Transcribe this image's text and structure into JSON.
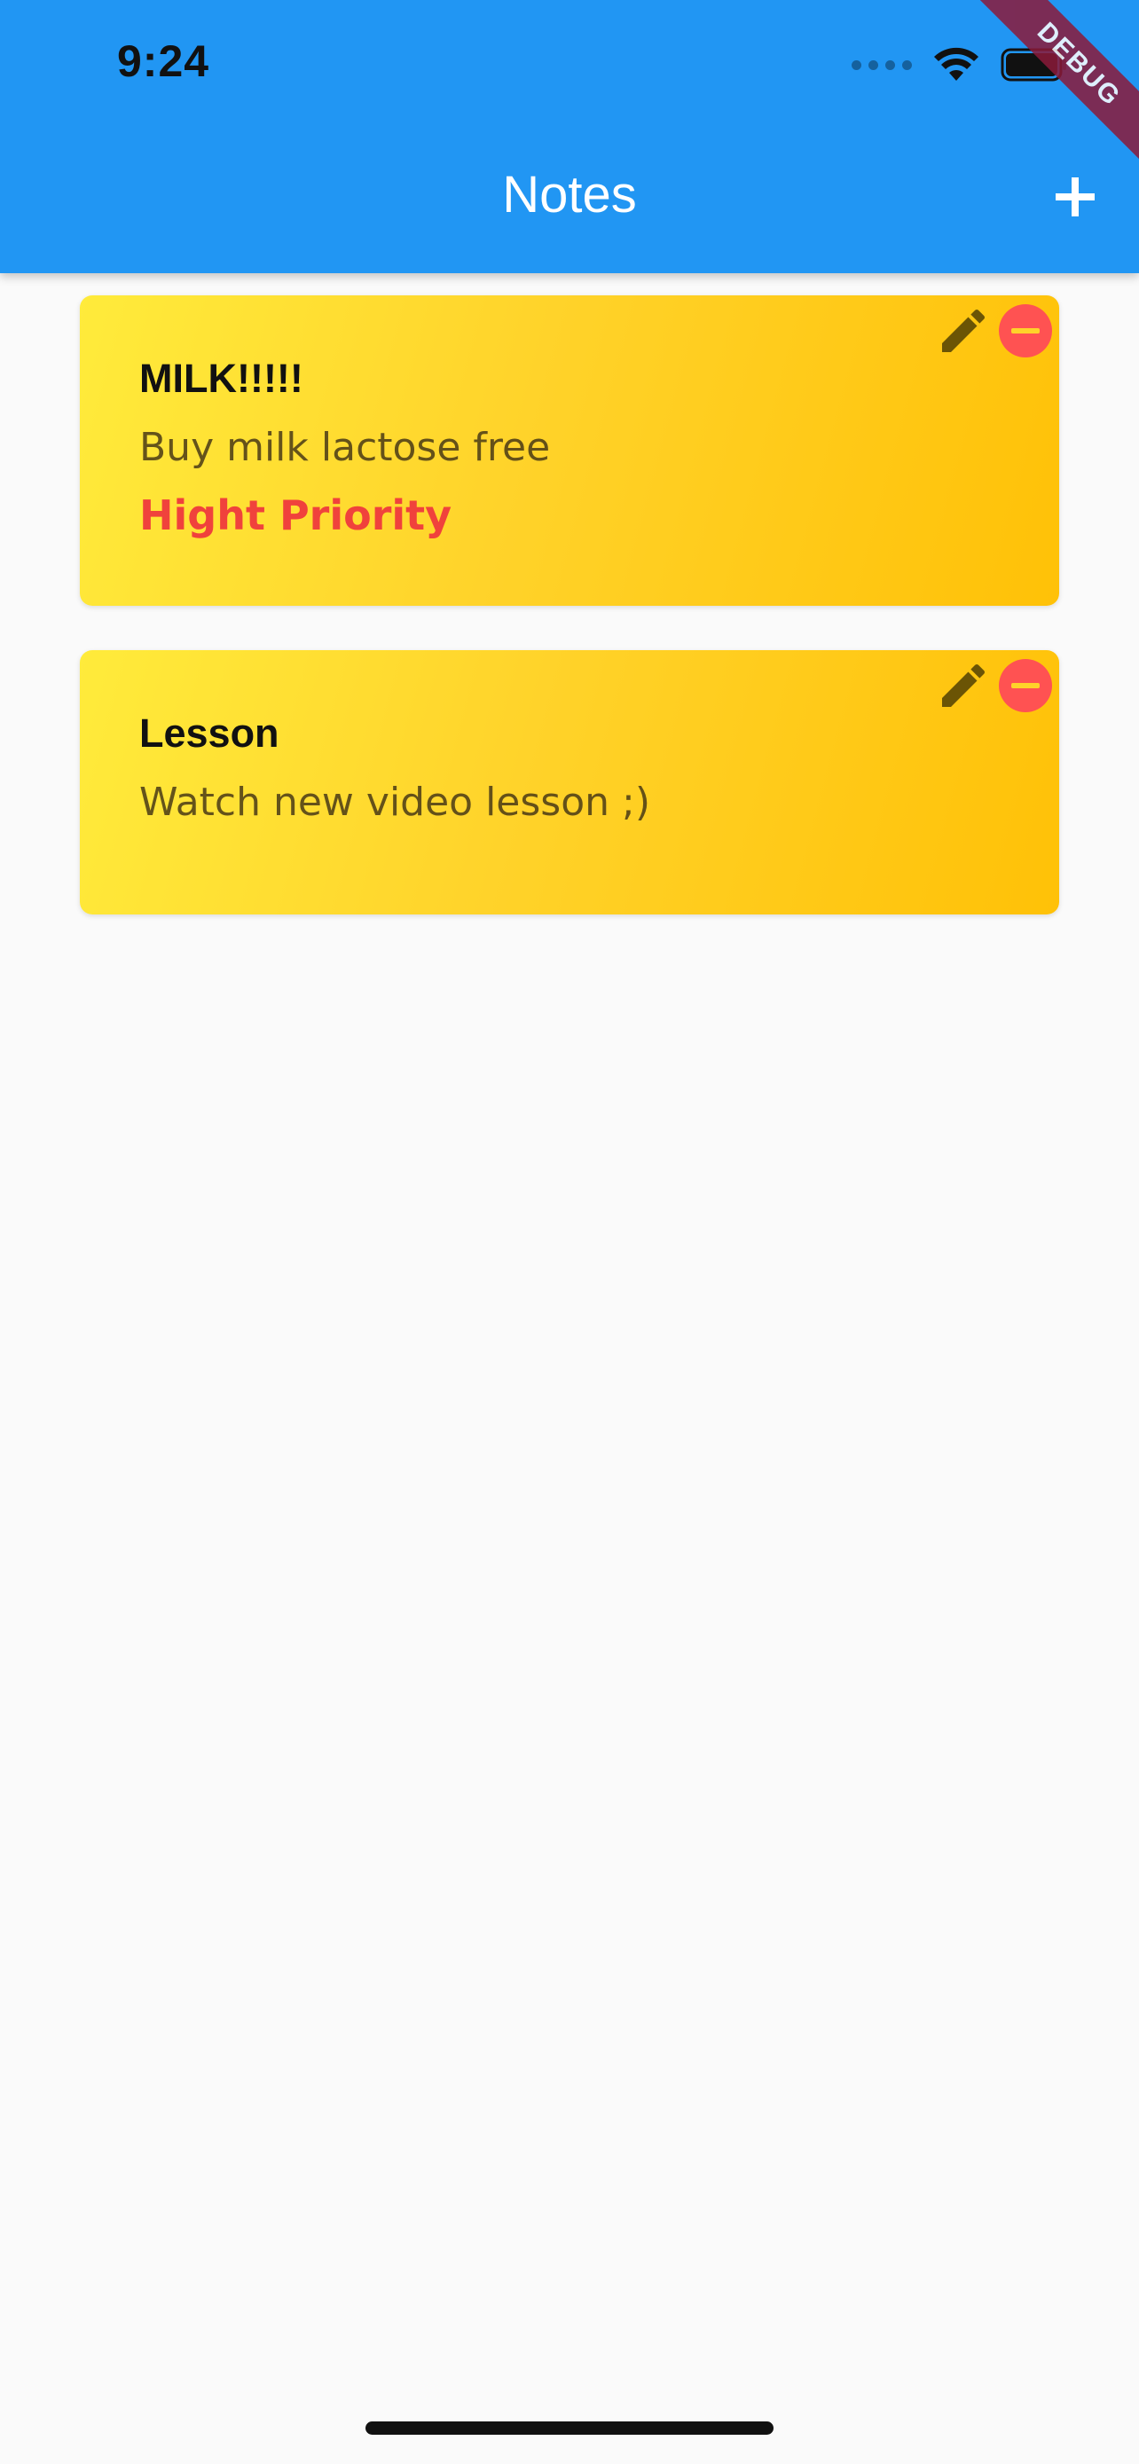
{
  "status_bar": {
    "time": "9:24"
  },
  "app_bar": {
    "title": "Notes",
    "add_icon": "plus-icon",
    "background_color": "#2196F3"
  },
  "debug_banner": {
    "label": "DEBUG"
  },
  "notes": [
    {
      "title": "MILK!!!!!",
      "body": "Buy milk lactose free",
      "priority": "Hight Priority",
      "edit_icon": "pencil-icon",
      "delete_icon": "minus-circle-icon"
    },
    {
      "title": "Lesson",
      "body": "Watch new video lesson ;)",
      "edit_icon": "pencil-icon",
      "delete_icon": "minus-circle-icon"
    }
  ],
  "colors": {
    "card_gradient_start": "#ffeb3b",
    "card_gradient_end": "#ffc107",
    "priority_text": "#f0423c",
    "delete_button": "#ff5252",
    "page_background": "#fafafa"
  }
}
